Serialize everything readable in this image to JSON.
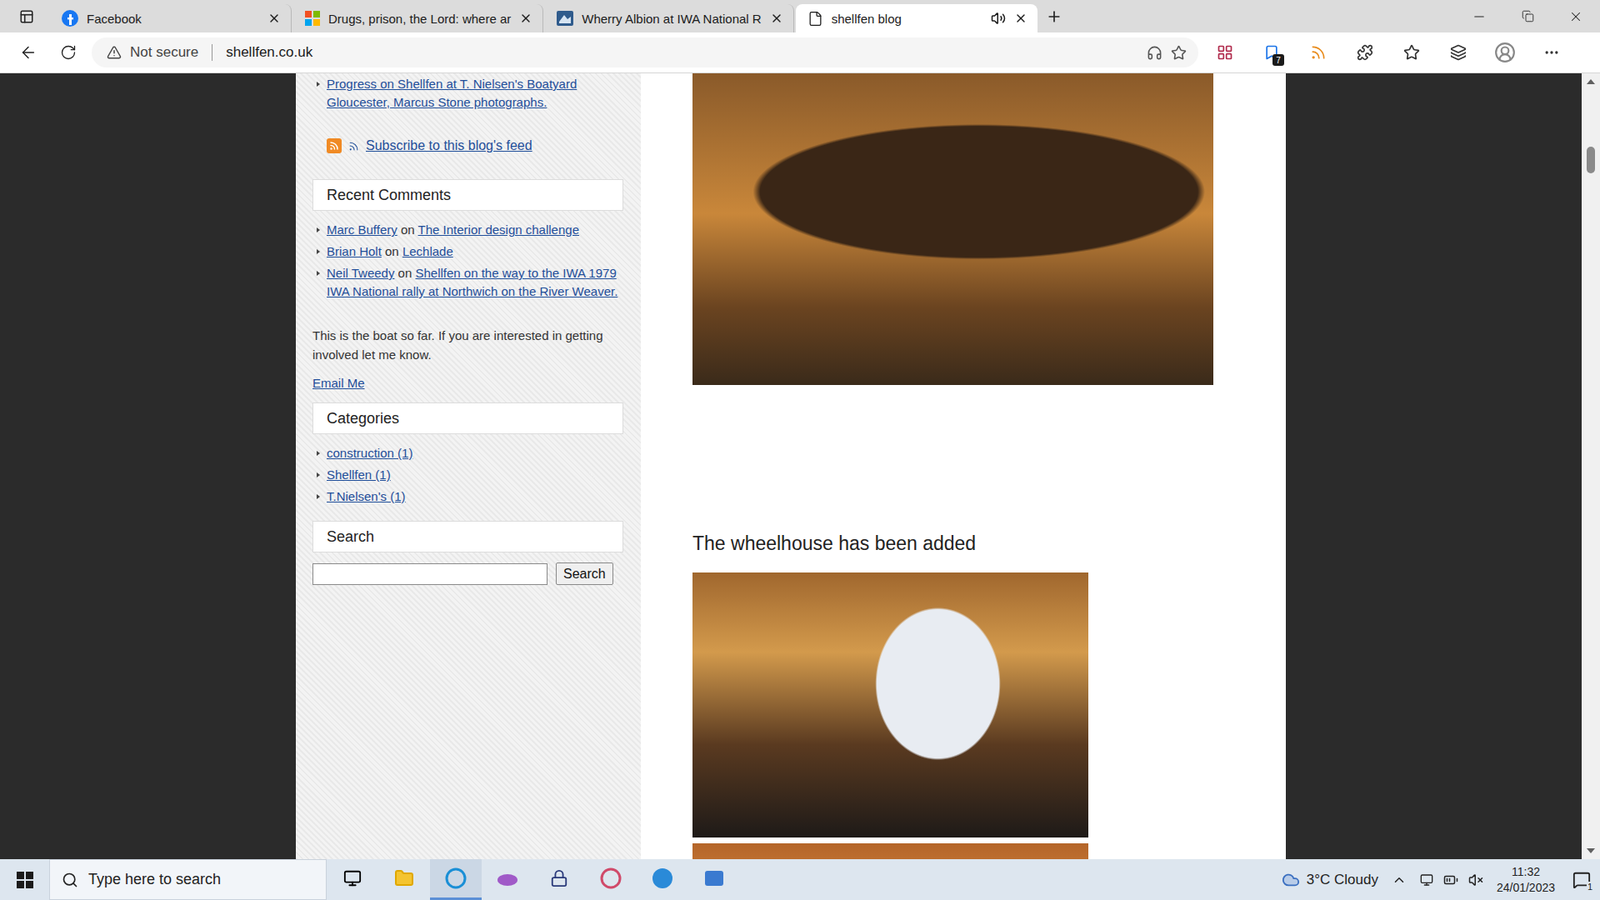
{
  "browser": {
    "tabs": [
      {
        "label": "Facebook",
        "selected": false,
        "kind": "facebook"
      },
      {
        "label": "Drugs, prison, the Lord: where ar",
        "selected": false,
        "kind": "microsoft"
      },
      {
        "label": "Wherry Albion at IWA National R",
        "selected": false,
        "kind": "site"
      },
      {
        "label": "shellfen blog",
        "selected": true,
        "kind": "page"
      }
    ],
    "address": {
      "security": "Not secure",
      "url": "shellfen.co.uk",
      "extension_badge": "7"
    }
  },
  "sidebar": {
    "top_link": "Progress on Shellfen at T. Nielsen's Boatyard Gloucester, Marcus Stone photographs.",
    "feed_link": "Subscribe to this blog's feed",
    "recent_comments": {
      "title": "Recent Comments",
      "items": [
        {
          "author": "Marc Buffery",
          "joiner": "on",
          "post": "The Interior design challenge"
        },
        {
          "author": "Brian Holt",
          "joiner": "on",
          "post": "Lechlade"
        },
        {
          "author": "Neil Tweedy",
          "joiner": "on",
          "post": "Shellfen on the way to the IWA 1979 IWA National rally at Northwich on the River Weaver."
        }
      ]
    },
    "about": "This is the boat so far. If you are interested in getting involved let me know.",
    "email": "Email Me",
    "categories": {
      "title": "Categories",
      "items": [
        "construction (1)",
        "Shellfen (1)",
        "T.Nielsen's (1)"
      ]
    },
    "search": {
      "title": "Search",
      "value": "",
      "button": "Search"
    }
  },
  "main": {
    "heading": "The wheelhouse has been added"
  },
  "taskbar": {
    "search_placeholder": "Type here to search",
    "weather": "3°C Cloudy",
    "time": "11:32",
    "date": "24/01/2023",
    "notifications": "1"
  }
}
